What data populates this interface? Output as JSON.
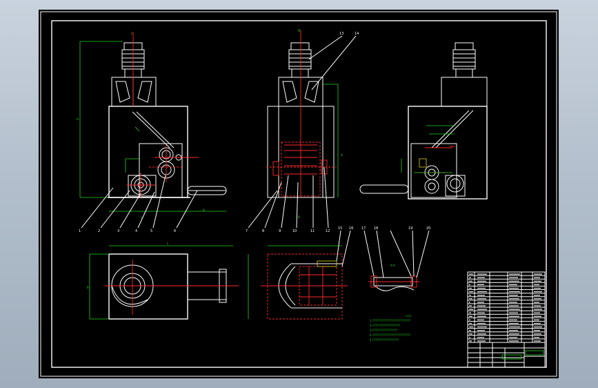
{
  "drawing": {
    "background_color": "#000000",
    "line_color": "#ffffff",
    "dimension_color": "#22d422",
    "centerline_color": "#ff2a2a"
  },
  "balloons": {
    "front_view": [
      "1",
      "2",
      "3",
      "4",
      "5",
      "6"
    ],
    "side_view": [
      "7",
      "8",
      "9",
      "10",
      "11",
      "12"
    ],
    "top_right": [
      "13",
      "14"
    ],
    "top_view": [
      "15",
      "16"
    ],
    "detail": [
      "17",
      "18",
      "19",
      "20"
    ]
  },
  "notes": {
    "heading": "????",
    "lines": [
      "1.??????????????????????????",
      "2.???????????????????",
      "3.?????????????????",
      "4.??????????????????????????",
      "5.??????????????????"
    ]
  }
}
